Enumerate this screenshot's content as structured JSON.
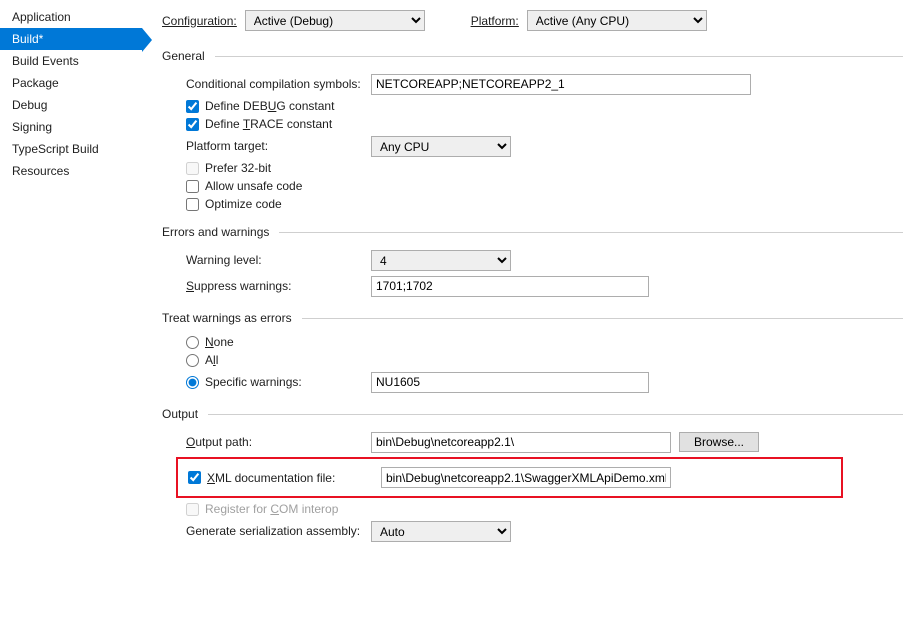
{
  "sidebar": {
    "items": [
      {
        "label": "Application"
      },
      {
        "label": "Build*"
      },
      {
        "label": "Build Events"
      },
      {
        "label": "Package"
      },
      {
        "label": "Debug"
      },
      {
        "label": "Signing"
      },
      {
        "label": "TypeScript Build"
      },
      {
        "label": "Resources"
      }
    ]
  },
  "top": {
    "config_label": "Configuration:",
    "config_value": "Active (Debug)",
    "platform_label": "Platform:",
    "platform_value": "Active (Any CPU)"
  },
  "general": {
    "title": "General",
    "cond_label": "Conditional compilation symbols:",
    "cond_value": "NETCOREAPP;NETCOREAPP2_1",
    "define_debug_pre": "Define DEB",
    "define_debug_u": "U",
    "define_debug_post": "G constant",
    "define_trace_pre": "Define ",
    "define_trace_u": "T",
    "define_trace_post": "RACE constant",
    "platform_target_label": "Platform target:",
    "platform_target_value": "Any CPU",
    "prefer32_label": "Prefer 32-bit",
    "unsafe_label": "Allow unsafe code",
    "optimize_label": "Optimize code"
  },
  "errors": {
    "title": "Errors and warnings",
    "warning_level_label": "Warning level:",
    "warning_level_value": "4",
    "suppress_pre": "",
    "suppress_u": "S",
    "suppress_post": "uppress warnings:",
    "suppress_value": "1701;1702"
  },
  "treat": {
    "title": "Treat warnings as errors",
    "none_u": "N",
    "none_post": "one",
    "all_pre": "A",
    "all_u": "l",
    "all_post": "l",
    "specific_label": "Specific warnings:",
    "specific_value": "NU1605"
  },
  "output": {
    "title": "Output",
    "path_u": "O",
    "path_post": "utput path:",
    "path_value": "bin\\Debug\\netcoreapp2.1\\",
    "browse_label": "Browse...",
    "xml_u": "X",
    "xml_post": "ML documentation file:",
    "xml_value": "bin\\Debug\\netcoreapp2.1\\SwaggerXMLApiDemo.xml",
    "com_pre": "Register for ",
    "com_u": "C",
    "com_post": "OM interop",
    "serialize_label": "Generate serialization assembly:",
    "serialize_value": "Auto"
  }
}
